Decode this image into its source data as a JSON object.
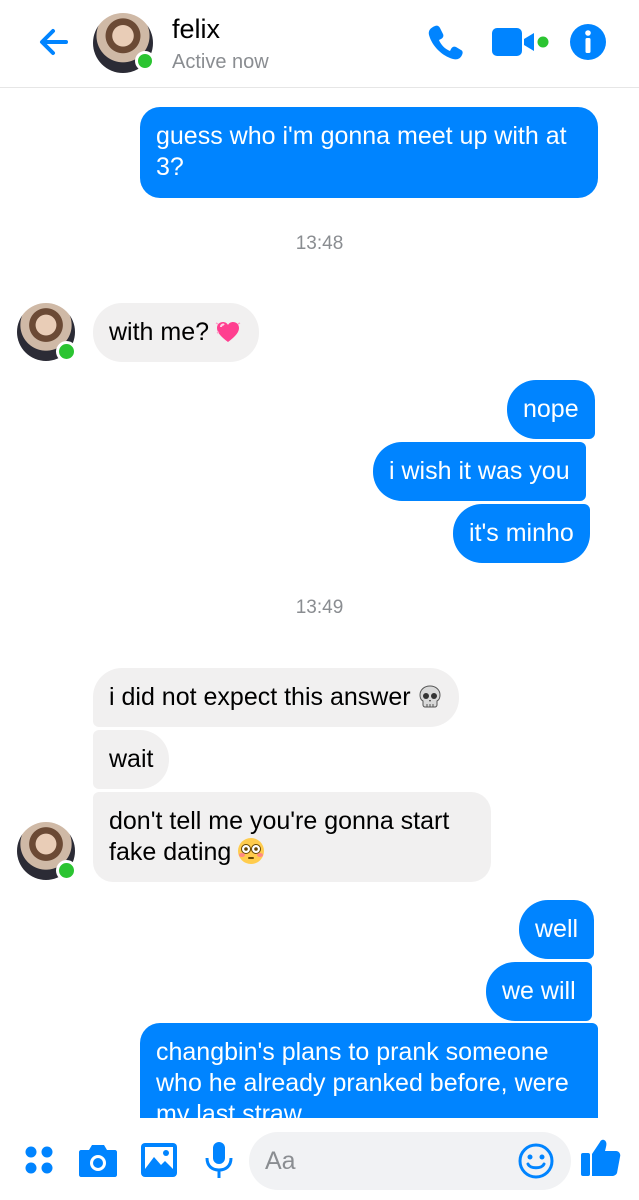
{
  "header": {
    "name": "felix",
    "status": "Active now",
    "accent": "#0084ff",
    "online_color": "#2bc431"
  },
  "messages": [
    {
      "side": "out",
      "text": "guess who i'm gonna meet up with at 3?"
    },
    {
      "side": "time",
      "text": "13:48"
    },
    {
      "side": "in",
      "text": "with me?",
      "emoji": "heart-sparkle-emoji"
    },
    {
      "side": "out",
      "text": "nope"
    },
    {
      "side": "out",
      "text": "i wish it was you"
    },
    {
      "side": "out",
      "text": "it's minho"
    },
    {
      "side": "time",
      "text": "13:49"
    },
    {
      "side": "in",
      "text": "i did not expect this answer",
      "emoji": "skull-emoji"
    },
    {
      "side": "in",
      "text": "wait"
    },
    {
      "side": "in",
      "text": "don't tell me you're gonna start fake dating",
      "emoji": "flushed-face-emoji"
    },
    {
      "side": "out",
      "text": "well"
    },
    {
      "side": "out",
      "text": "we will"
    },
    {
      "side": "out",
      "text": "changbin's plans to prank someone who he already pranked before, were my last straw"
    }
  ],
  "composer": {
    "placeholder": "Aa",
    "icons": [
      "menu-dots-icon",
      "camera-icon",
      "gallery-icon",
      "microphone-icon",
      "emoji-icon",
      "thumbs-up-icon"
    ]
  },
  "colors": {
    "outgoing_bubble": "#0084ff",
    "incoming_bubble": "#f1f0f0",
    "muted_text": "#8a8d91"
  }
}
